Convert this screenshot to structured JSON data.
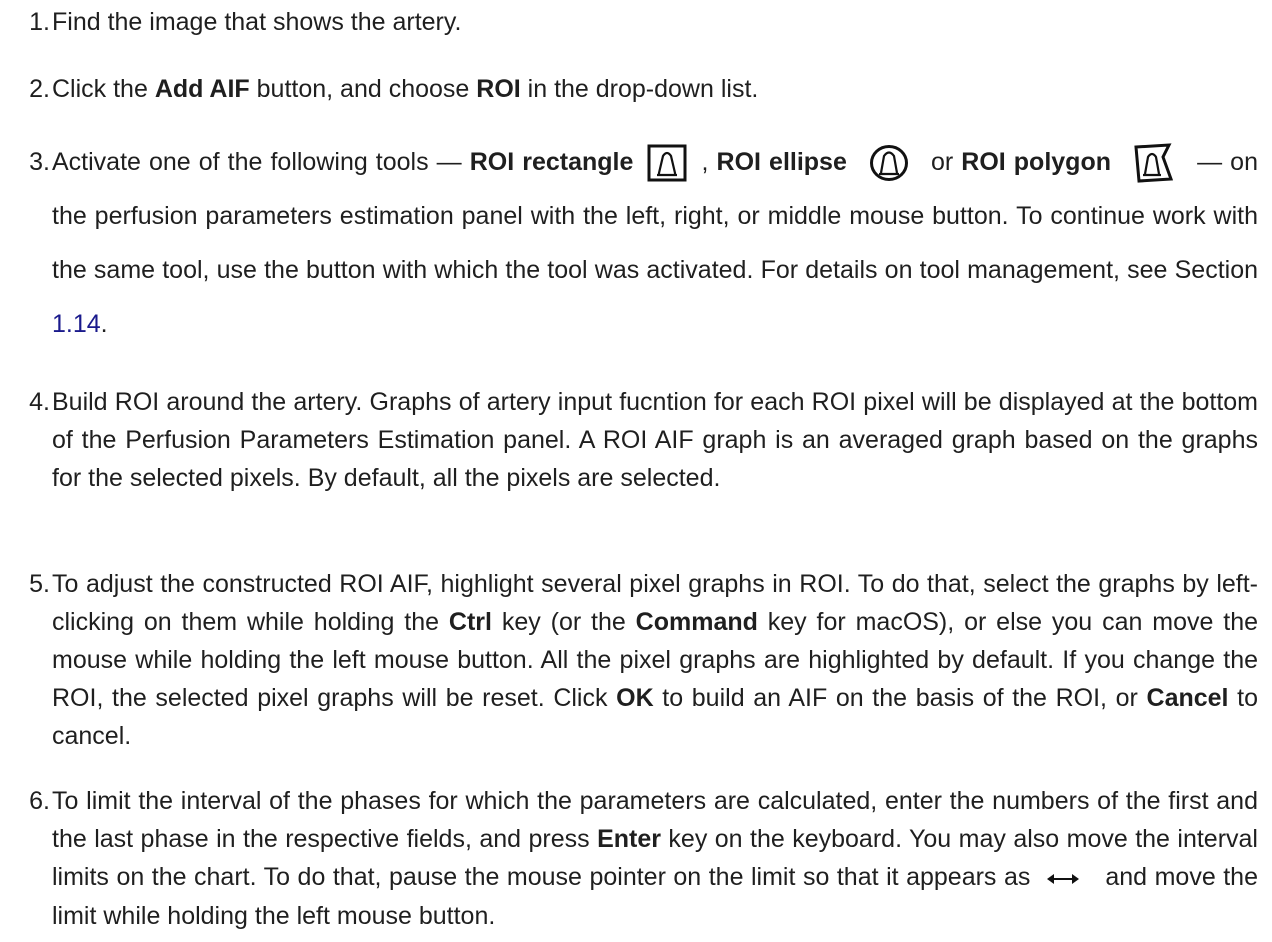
{
  "steps": [
    {
      "number": "1.",
      "text": "Find the image that shows the artery."
    },
    {
      "number": "2.",
      "t1": "Click the ",
      "b1": "Add AIF",
      "t2": " button, and choose ",
      "b2": "ROI",
      "t3": " in the drop-down list."
    },
    {
      "number": "3.",
      "t1": "Activate one of the following tools — ",
      "b1": "ROI rectangle",
      "t2": " , ",
      "b2": "ROI ellipse",
      "t3": " or ",
      "b3": "ROI polygon",
      "t4": " — on the perfusion parameters estimation panel with the left, right, or middle mouse button. To continue work with the same tool, use the button with which the tool was activated. For details on tool management, see Section ",
      "link": "1.14",
      "t5": "."
    },
    {
      "number": "4.",
      "text": "Build ROI around the artery. Graphs of artery input fucntion for each ROI pixel will be displayed at the bottom of the Perfusion Parameters Estimation panel. A ROI AIF graph is an averaged graph based on the graphs for the selected pixels. By default, all the pixels are selected."
    },
    {
      "number": "5.",
      "t1": "To adjust the constructed ROI AIF, highlight several pixel graphs in ROI. To do that, select the graphs by left-clicking on them while holding the ",
      "b1": "Ctrl",
      "t2": " key (or the ",
      "b2": "Command",
      "t3": " key for macOS), or else you can move the mouse while holding the left mouse button. All the pixel graphs are highlighted by default. If you change the ROI, the selected pixel graphs will be reset. Click ",
      "b3": "OK",
      "t4": " to build an AIF on the basis of the ROI, or ",
      "b4": "Cancel",
      "t5": " to cancel."
    },
    {
      "number": "6.",
      "t1": "To limit the interval of the phases for which the parameters are calculated, enter the numbers of the first and the last phase in the respective fields, and press ",
      "b1": "Enter",
      "t2": " key on the keyboard. You may also move the interval limits on the chart. To do that, pause the mouse pointer on the limit so that it appears as ",
      "t3": " and move the limit while holding the left mouse button."
    }
  ],
  "icons": {
    "roi_rectangle": "roi-rectangle-icon",
    "roi_ellipse": "roi-ellipse-icon",
    "roi_polygon": "roi-polygon-icon",
    "resize_cursor": "horizontal-resize-arrow-icon"
  }
}
